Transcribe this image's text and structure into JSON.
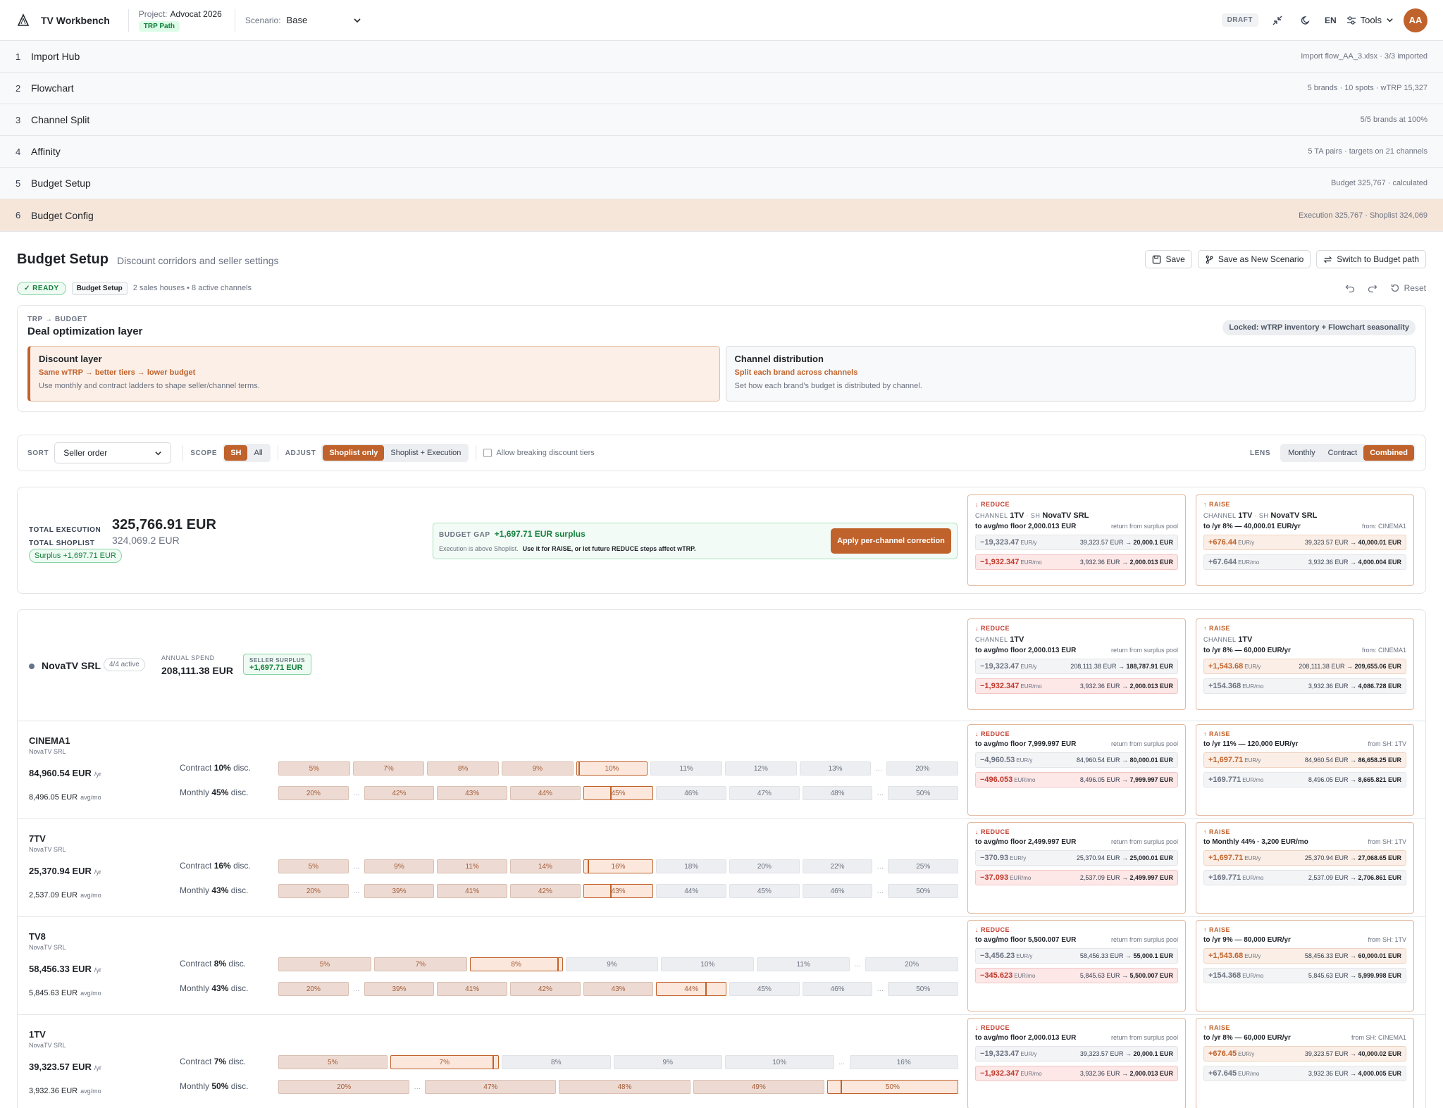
{
  "header": {
    "app": "TV Workbench",
    "project_label": "Project:",
    "project": "Advocat 2026",
    "path_badge": "TRP Path",
    "scenario_label": "Scenario:",
    "scenario": "Base",
    "draft": "DRAFT",
    "lang": "EN",
    "tools": "Tools",
    "avatar": "AA"
  },
  "steps": [
    {
      "n": "1",
      "title": "Import Hub",
      "meta": "Import flow_AA_3.xlsx · 3/3 imported"
    },
    {
      "n": "2",
      "title": "Flowchart",
      "meta": "5 brands · 10 spots · wTRP 15,327"
    },
    {
      "n": "3",
      "title": "Channel Split",
      "meta": "5/5 brands at 100%"
    },
    {
      "n": "4",
      "title": "Affinity",
      "meta": "5 TA pairs · targets on 21 channels"
    },
    {
      "n": "5",
      "title": "Budget Setup",
      "meta": "Budget 325,767 · calculated"
    },
    {
      "n": "6",
      "title": "Budget Config",
      "meta": "Execution 325,767 · Shoplist 324,069"
    }
  ],
  "page": {
    "title": "Budget Setup",
    "subtitle": "Discount corridors and seller settings",
    "save": "Save",
    "save_new": "Save as New Scenario",
    "switch": "Switch to Budget path",
    "ready": "READY",
    "tag": "Budget Setup",
    "status": "2 sales houses • 8 active channels",
    "reset": "Reset"
  },
  "dol": {
    "kicker": "TRP → BUDGET",
    "title": "Deal optimization layer",
    "locked": "Locked: wTRP inventory + Flowchart seasonality",
    "discount": {
      "title": "Discount layer",
      "sub": "Same wTRP → better tiers → lower budget",
      "desc": "Use monthly and contract ladders to shape seller/channel terms."
    },
    "channel": {
      "title": "Channel distribution",
      "sub": "Split each brand across channels",
      "desc": "Set how each brand's budget is distributed by channel."
    }
  },
  "controls": {
    "sort_label": "SORT",
    "sort": "Seller order",
    "scope_label": "SCOPE",
    "scope": [
      "SH",
      "All"
    ],
    "adjust_label": "ADJUST",
    "adjust": [
      "Shoplist only",
      "Shoplist + Execution"
    ],
    "allow": "Allow breaking discount tiers",
    "lens_label": "LENS",
    "lens": [
      "Monthly",
      "Contract",
      "Combined"
    ]
  },
  "summary": {
    "exec_label": "TOTAL EXECUTION",
    "exec": "325,766.91 EUR",
    "shop_label": "TOTAL SHOPLIST",
    "shop": "324,069.2 EUR",
    "surplus": "Surplus +1,697.71 EUR",
    "gap_label": "BUDGET GAP",
    "gap_value": "+1,697.71 EUR surplus",
    "gap_note": "Execution is above Shoplist.",
    "gap_hint": "Use it for RAISE, or let future REDUCE steps affect wTRP.",
    "apply": "Apply per-channel correction"
  },
  "seller": {
    "name": "NovaTV SRL",
    "active": "4/4 active",
    "spend_label": "ANNUAL SPEND",
    "spend": "208,111.38 EUR",
    "surplus_label": "SELLER SURPLUS",
    "surplus": "+1,697.71 EUR"
  },
  "cards": {
    "sum_reduce": {
      "kind": "↓ REDUCE",
      "channel": "1TV",
      "sh": "NovaTV SRL",
      "target": "to avg/mo floor 2,000.013 EUR",
      "note": "return from surplus pool",
      "v1": "−19,323.47",
      "u1": "EUR/y",
      "t1a": "39,323.57 EUR → ",
      "t1b": "20,000.1 EUR",
      "v2": "−1,932.347",
      "u2": "EUR/mo",
      "t2a": "3,932.36 EUR → ",
      "t2b": "2,000.013 EUR"
    },
    "sum_raise": {
      "kind": "↑ RAISE",
      "channel": "1TV",
      "sh": "NovaTV SRL",
      "target": "to /yr 8% — 40,000.01 EUR/yr",
      "note": "from: CINEMA1",
      "v1": "+676.44",
      "u1": "EUR/y",
      "t1a": "39,323.57 EUR → ",
      "t1b": "40,000.01 EUR",
      "v2": "+67.644",
      "u2": "EUR/mo",
      "t2a": "3,932.36 EUR → ",
      "t2b": "4,000.004 EUR"
    },
    "sel_reduce": {
      "kind": "↓ REDUCE",
      "channel": "1TV",
      "target": "to avg/mo floor 2,000.013 EUR",
      "note": "return from surplus pool",
      "v1": "−19,323.47",
      "u1": "EUR/y",
      "t1a": "208,111.38 EUR → ",
      "t1b": "188,787.91 EUR",
      "v2": "−1,932.347",
      "u2": "EUR/mo",
      "t2a": "3,932.36 EUR → ",
      "t2b": "2,000.013 EUR"
    },
    "sel_raise": {
      "kind": "↑ RAISE",
      "channel": "1TV",
      "target": "to /yr 8% — 60,000 EUR/yr",
      "note": "from: CINEMA1",
      "v1": "+1,543.68",
      "u1": "EUR/y",
      "t1a": "208,111.38 EUR → ",
      "t1b": "209,655.06 EUR",
      "v2": "+154.368",
      "u2": "EUR/mo",
      "t2a": "3,932.36 EUR → ",
      "t2b": "4,086.728 EUR"
    }
  },
  "channels": [
    {
      "name": "CINEMA1",
      "seller": "NovaTV SRL",
      "yr": "84,960.54 EUR",
      "yr_u": "/yr",
      "mo": "8,496.05 EUR",
      "mo_u": "avg/mo",
      "contract_label": "Contract",
      "contract": "10%",
      "monthly_label": "Monthly",
      "monthly": "45%",
      "disc": "disc.",
      "ctiers": [
        "5%",
        "7%",
        "8%",
        "9%",
        "10%",
        "11%",
        "12%",
        "13%",
        "…",
        "20%"
      ],
      "mtiers": [
        "20%",
        "…",
        "42%",
        "43%",
        "44%",
        "45%",
        "46%",
        "47%",
        "48%",
        "…",
        "50%"
      ],
      "reduce": {
        "kind": "↓ REDUCE",
        "target": "to avg/mo floor 7,999.997 EUR",
        "note": "return from surplus pool",
        "v1": "−4,960.53",
        "u1": "EUR/y",
        "t1a": "84,960.54 EUR → ",
        "t1b": "80,000.01 EUR",
        "v2": "−496.053",
        "u2": "EUR/mo",
        "t2a": "8,496.05 EUR → ",
        "t2b": "7,999.997 EUR"
      },
      "raise": {
        "kind": "↑ RAISE",
        "target": "to /yr 11% — 120,000 EUR/yr",
        "note": "from SH: 1TV",
        "v1": "+1,697.71",
        "u1": "EUR/y",
        "t1a": "84,960.54 EUR → ",
        "t1b": "86,658.25 EUR",
        "v2": "+169.771",
        "u2": "EUR/mo",
        "t2a": "8,496.05 EUR → ",
        "t2b": "8,665.821 EUR"
      }
    },
    {
      "name": "7TV",
      "seller": "NovaTV SRL",
      "yr": "25,370.94 EUR",
      "yr_u": "/yr",
      "mo": "2,537.09 EUR",
      "mo_u": "avg/mo",
      "contract_label": "Contract",
      "contract": "16%",
      "monthly_label": "Monthly",
      "monthly": "43%",
      "disc": "disc.",
      "ctiers": [
        "5%",
        "…",
        "9%",
        "11%",
        "14%",
        "16%",
        "18%",
        "20%",
        "22%",
        "…",
        "25%"
      ],
      "mtiers": [
        "20%",
        "…",
        "39%",
        "41%",
        "42%",
        "43%",
        "44%",
        "45%",
        "46%",
        "…",
        "50%"
      ],
      "reduce": {
        "kind": "↓ REDUCE",
        "target": "to avg/mo floor 2,499.997 EUR",
        "note": "return from surplus pool",
        "v1": "−370.93",
        "u1": "EUR/y",
        "t1a": "25,370.94 EUR → ",
        "t1b": "25,000.01 EUR",
        "v2": "−37.093",
        "u2": "EUR/mo",
        "t2a": "2,537.09 EUR → ",
        "t2b": "2,499.997 EUR"
      },
      "raise": {
        "kind": "↑ RAISE",
        "target": "to Monthly 44% · 3,200 EUR/mo",
        "note": "from SH: 1TV",
        "v1": "+1,697.71",
        "u1": "EUR/y",
        "t1a": "25,370.94 EUR → ",
        "t1b": "27,068.65 EUR",
        "v2": "+169.771",
        "u2": "EUR/mo",
        "t2a": "2,537.09 EUR → ",
        "t2b": "2,706.861 EUR"
      }
    },
    {
      "name": "TV8",
      "seller": "NovaTV SRL",
      "yr": "58,456.33 EUR",
      "yr_u": "/yr",
      "mo": "5,845.63 EUR",
      "mo_u": "avg/mo",
      "contract_label": "Contract",
      "contract": "8%",
      "monthly_label": "Monthly",
      "monthly": "43%",
      "disc": "disc.",
      "ctiers": [
        "5%",
        "7%",
        "8%",
        "9%",
        "10%",
        "11%",
        "…",
        "20%"
      ],
      "mtiers": [
        "20%",
        "…",
        "39%",
        "41%",
        "42%",
        "43%",
        "44%",
        "45%",
        "46%",
        "…",
        "50%"
      ],
      "reduce": {
        "kind": "↓ REDUCE",
        "target": "to avg/mo floor 5,500.007 EUR",
        "note": "return from surplus pool",
        "v1": "−3,456.23",
        "u1": "EUR/y",
        "t1a": "58,456.33 EUR → ",
        "t1b": "55,000.1 EUR",
        "v2": "−345.623",
        "u2": "EUR/mo",
        "t2a": "5,845.63 EUR → ",
        "t2b": "5,500.007 EUR"
      },
      "raise": {
        "kind": "↑ RAISE",
        "target": "to /yr 9% — 80,000 EUR/yr",
        "note": "from SH: 1TV",
        "v1": "+1,543.68",
        "u1": "EUR/y",
        "t1a": "58,456.33 EUR → ",
        "t1b": "60,000.01 EUR",
        "v2": "+154.368",
        "u2": "EUR/mo",
        "t2a": "5,845.63 EUR → ",
        "t2b": "5,999.998 EUR"
      }
    },
    {
      "name": "1TV",
      "seller": "NovaTV SRL",
      "yr": "39,323.57 EUR",
      "yr_u": "/yr",
      "mo": "3,932.36 EUR",
      "mo_u": "avg/mo",
      "contract_label": "Contract",
      "contract": "7%",
      "monthly_label": "Monthly",
      "monthly": "50%",
      "disc": "disc.",
      "ctiers": [
        "5%",
        "7%",
        "8%",
        "9%",
        "10%",
        "…",
        "16%"
      ],
      "mtiers": [
        "20%",
        "…",
        "47%",
        "48%",
        "49%",
        "50%"
      ],
      "reduce": {
        "kind": "↓ REDUCE",
        "target": "to avg/mo floor 2,000.013 EUR",
        "note": "return from surplus pool",
        "v1": "−19,323.47",
        "u1": "EUR/y",
        "t1a": "39,323.57 EUR → ",
        "t1b": "20,000.1 EUR",
        "v2": "−1,932.347",
        "u2": "EUR/mo",
        "t2a": "3,932.36 EUR → ",
        "t2b": "2,000.013 EUR"
      },
      "raise": {
        "kind": "↑ RAISE",
        "target": "to /yr 8% — 60,000 EUR/yr",
        "note": "from SH: CINEMA1",
        "v1": "+676.45",
        "u1": "EUR/y",
        "t1a": "39,323.57 EUR → ",
        "t1b": "40,000.02 EUR",
        "v2": "+67.645",
        "u2": "EUR/mo",
        "t2a": "3,932.36 EUR → ",
        "t2b": "4,000.005 EUR"
      }
    }
  ]
}
